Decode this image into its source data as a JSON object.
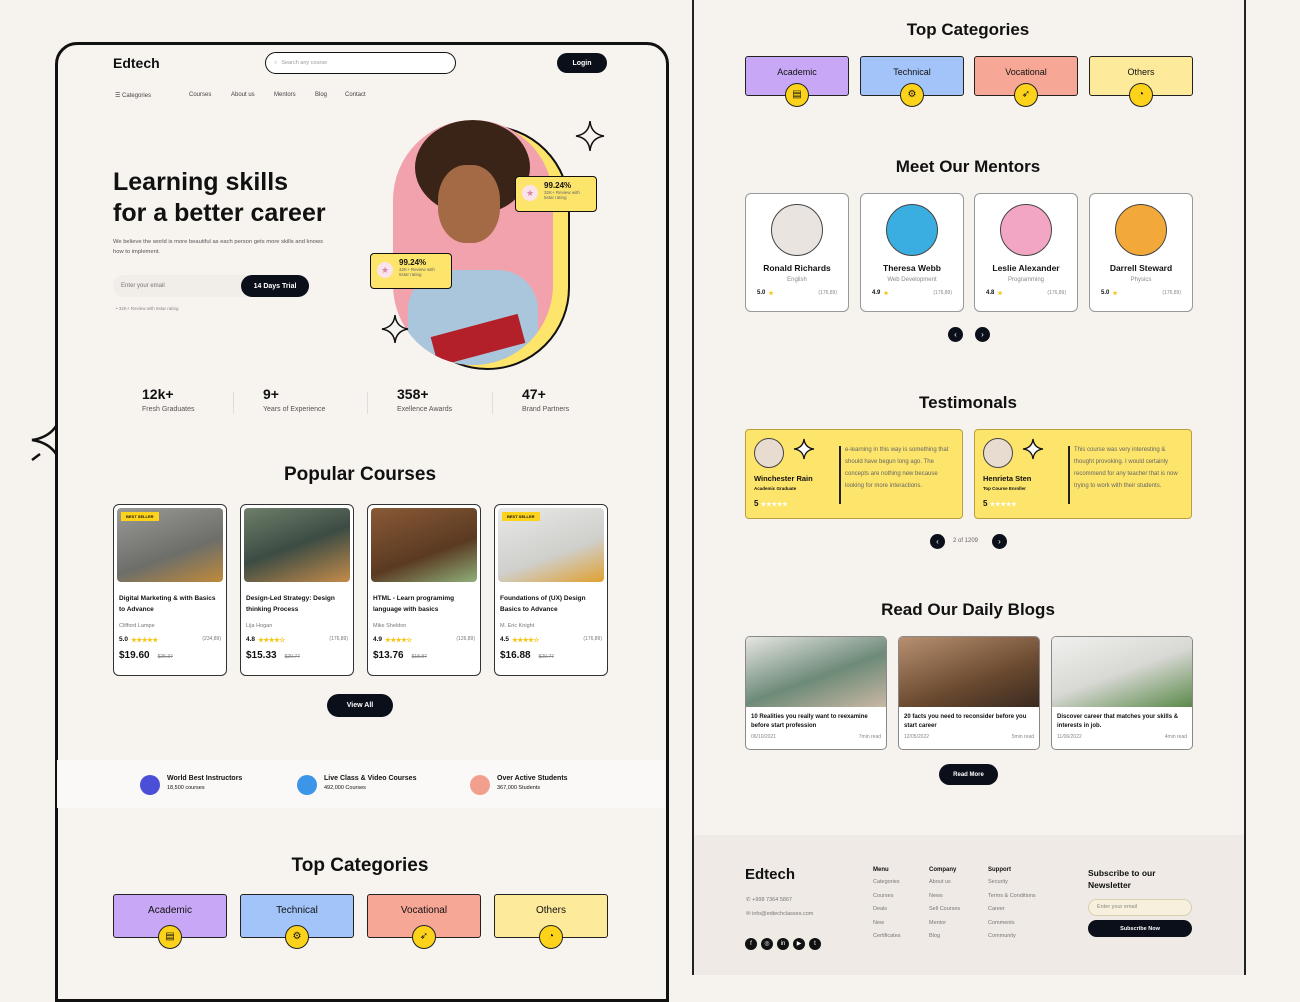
{
  "brand": "Edtech",
  "header": {
    "search_placeholder": "Search any course",
    "login": "Login"
  },
  "nav": {
    "categories": "Categories",
    "items": [
      "Courses",
      "About us",
      "Mentors",
      "Blog",
      "Contact"
    ]
  },
  "hero": {
    "title_line1": "Learning skills",
    "title_line2": "for a better career",
    "subtitle": "We believe the world is more beautiful as each person gets more skills and knows how to implement.",
    "email_placeholder": "Enter your email",
    "trial_button": "14 Days Trial",
    "note": "32K+ Review with 5star rating",
    "badges": [
      {
        "value": "99.24%",
        "text": "32K+ Review with 5star rating"
      },
      {
        "value": "99.24%",
        "text": "32K+ Review with 5star rating"
      }
    ]
  },
  "stats": [
    {
      "value": "12k+",
      "label": "Fresh Graduates"
    },
    {
      "value": "9+",
      "label": "Years of Experience"
    },
    {
      "value": "358+",
      "label": "Exellence Awards"
    },
    {
      "value": "47+",
      "label": "Brand Partners"
    }
  ],
  "popular": {
    "title": "Popular Courses",
    "view_all": "View All",
    "courses": [
      {
        "badge": "BEST SELLER",
        "title": "Digital Marketing & with Basics to Advance",
        "author": "Clifford Lampe",
        "rating": "5.0",
        "stars": "★★★★★",
        "reviews": "(234,89)",
        "price": "$19.60",
        "old_price": "$25.37"
      },
      {
        "badge": "",
        "title": "Design-Led Strategy: Design thinking Process",
        "author": "Lija Hogan",
        "rating": "4.8",
        "stars": "★★★★☆",
        "reviews": "(176,89)",
        "price": "$15.33",
        "old_price": "$20.77"
      },
      {
        "badge": "",
        "title": "HTML - Learn programimg language with basics",
        "author": "Mike Sheldon",
        "rating": "4.9",
        "stars": "★★★★☆",
        "reviews": "(126,89)",
        "price": "$13.76",
        "old_price": "$18.87"
      },
      {
        "badge": "BEST SELLER",
        "title": "Foundations of (UX) Design Basics to Advance",
        "author": "M. Eric Knight",
        "rating": "4.5",
        "stars": "★★★★☆",
        "reviews": "(176,89)",
        "price": "$16.88",
        "old_price": "$20.77"
      }
    ]
  },
  "features": [
    {
      "title": "World Best Instructors",
      "sub": "18,500 courses",
      "color": "#4b4fd8"
    },
    {
      "title": "Live Class & Video Courses",
      "sub": "492,000  Courses",
      "color": "#3b95e8"
    },
    {
      "title": "Over Active Students",
      "sub": "367,000 Students",
      "color": "#f0a08c"
    }
  ],
  "categories": {
    "title": "Top Categories",
    "items": [
      {
        "label": "Academic",
        "color": "#c8a8f6",
        "icon": "book-icon"
      },
      {
        "label": "Technical",
        "color": "#a3c4f8",
        "icon": "gear-icon"
      },
      {
        "label": "Vocational",
        "color": "#f7a796",
        "icon": "rocket-icon"
      },
      {
        "label": "Others",
        "color": "#fdea9a",
        "icon": "chart-icon"
      }
    ]
  },
  "mentors": {
    "title": "Meet Our Mentors",
    "items": [
      {
        "name": "Ronald Richards",
        "subject": "English",
        "rating": "5.0",
        "reviews": "(176,89)",
        "color": "#e9e4e0"
      },
      {
        "name": "Theresa Webb",
        "subject": "Web Development",
        "rating": "4.9",
        "reviews": "(176,89)",
        "color": "#3aaee0"
      },
      {
        "name": "Leslie Alexander",
        "subject": "Programming",
        "rating": "4.8",
        "reviews": "(176,89)",
        "color": "#f2a6c4"
      },
      {
        "name": "Darrell Steward",
        "subject": "Physics",
        "rating": "5.0",
        "reviews": "(176,89)",
        "color": "#f3a93a"
      }
    ]
  },
  "testimonials": {
    "title": "Testimonals",
    "pager": "2 of 1209",
    "items": [
      {
        "name": "Winchester Rain",
        "role": "Academic Graduate",
        "rating": "5",
        "quote": "e-learning in this way is something that should have begun long ago. The concepts are nothing new because looking for more interactions."
      },
      {
        "name": "Henrieta Sten",
        "role": "Top Course Enroller",
        "rating": "5",
        "quote": "This course was very interesting & thought provoking. I would certainly recommend for any teacher that is now trying to work with their students."
      }
    ]
  },
  "blogs": {
    "title": "Read Our Daily Blogs",
    "read_more": "Read More",
    "items": [
      {
        "title": "10 Realities you really want to reexamine before start profession",
        "date": "06/10/2021",
        "read": "7min read"
      },
      {
        "title": "20 facts you need to reconsider before you start career",
        "date": "12/05/2022",
        "read": "5min read"
      },
      {
        "title": "Discover career that matches your skills & interests in job.",
        "date": "11/06/2022",
        "read": "4min read"
      }
    ]
  },
  "footer": {
    "phone": "+998 7364 5867",
    "email": "info@edtechclasses.com",
    "columns": [
      {
        "title": "Menu",
        "links": [
          "Categories",
          "Courses",
          "Deals",
          "New",
          "Certificates"
        ]
      },
      {
        "title": "Company",
        "links": [
          "About us",
          "News",
          "Sell Courses",
          "Mentor",
          "Blog"
        ]
      },
      {
        "title": "Support",
        "links": [
          "Security",
          "Terms & Conditions",
          "Career",
          "Comments",
          "Community"
        ]
      }
    ],
    "newsletter_title": "Subscribe to our Newsletter",
    "newsletter_placeholder": "Enter your email",
    "subscribe": "Subscribe Now",
    "social": [
      "facebook-icon",
      "instagram-icon",
      "linkedin-icon",
      "youtube-icon",
      "twitter-icon"
    ]
  },
  "colors": {
    "accent_yellow": "#fde46a",
    "dark": "#0b0f1a",
    "background": "#f6f2ee"
  }
}
